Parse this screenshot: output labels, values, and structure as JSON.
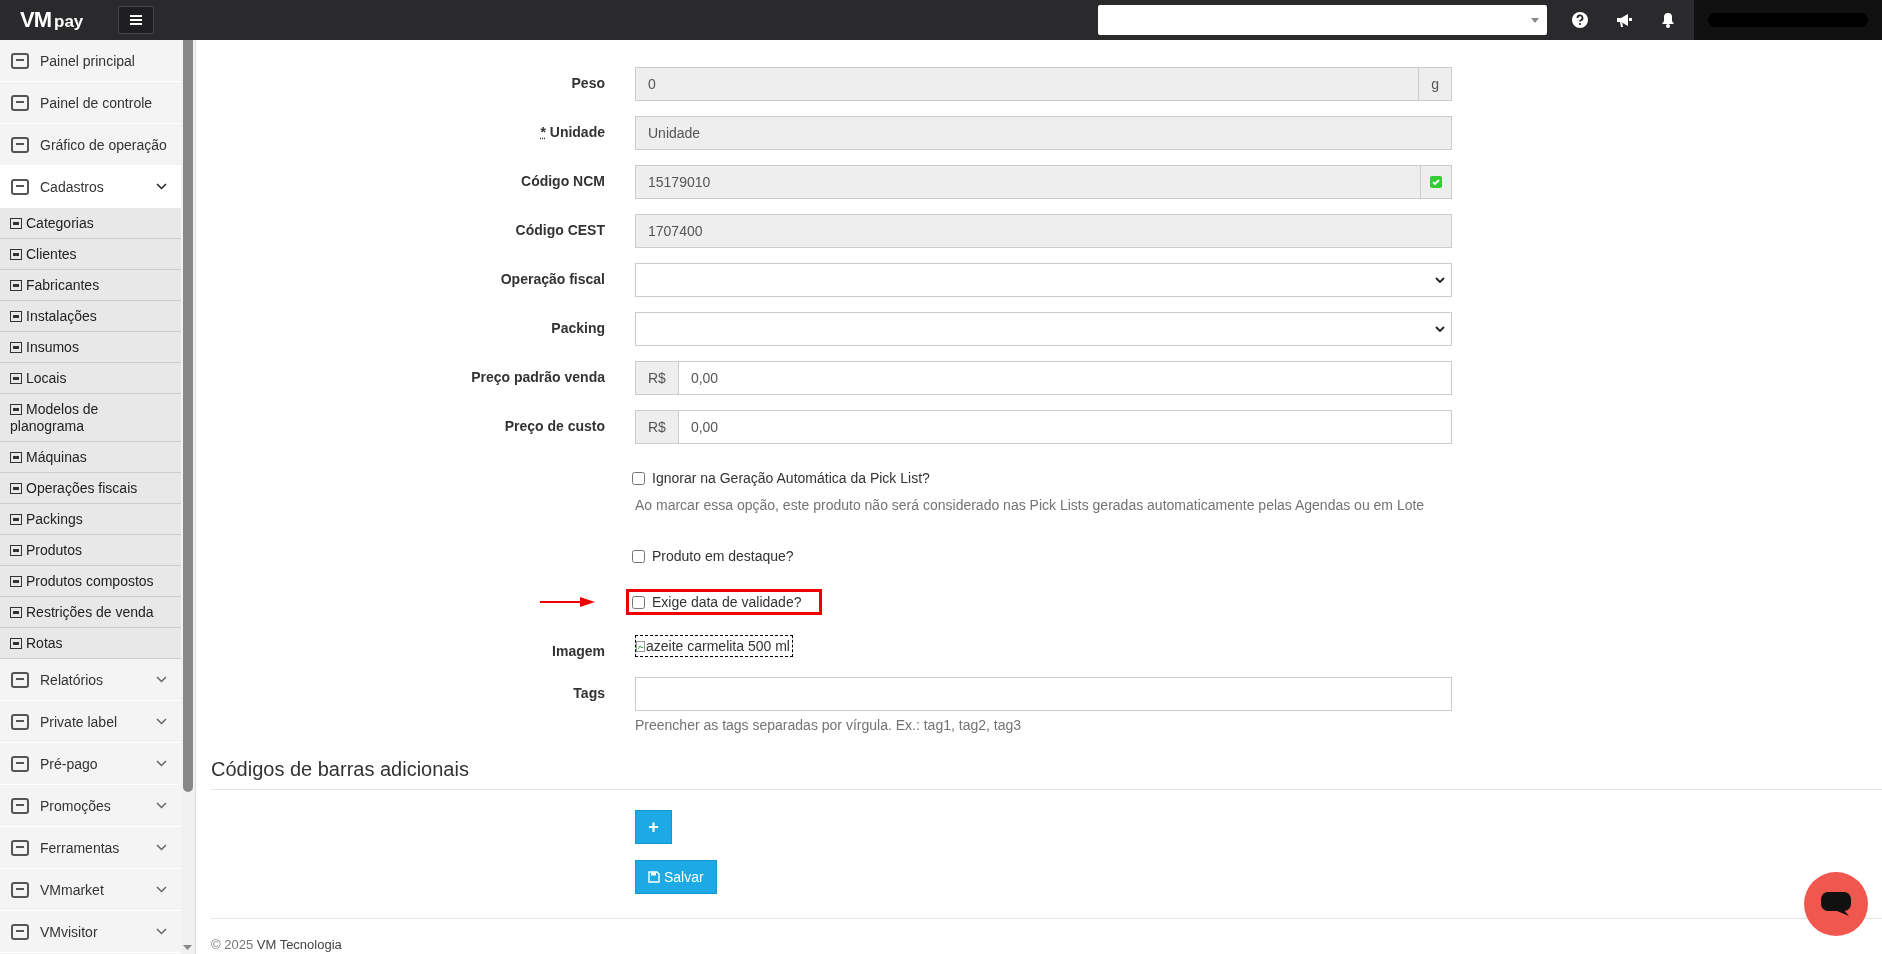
{
  "topbar": {
    "logo_main": "VM",
    "logo_sub": "pay"
  },
  "sidebar": {
    "items": [
      {
        "label": "Painel principal"
      },
      {
        "label": "Painel de controle"
      },
      {
        "label": "Gráfico de operação"
      },
      {
        "label": "Cadastros",
        "expanded": true,
        "children": [
          {
            "label": "Categorias"
          },
          {
            "label": "Clientes"
          },
          {
            "label": "Fabricantes"
          },
          {
            "label": "Instalações"
          },
          {
            "label": "Insumos"
          },
          {
            "label": "Locais"
          },
          {
            "label": "Modelos de planograma"
          },
          {
            "label": "Máquinas"
          },
          {
            "label": "Operações fiscais"
          },
          {
            "label": "Packings"
          },
          {
            "label": "Produtos"
          },
          {
            "label": "Produtos compostos"
          },
          {
            "label": "Restrições de venda"
          },
          {
            "label": "Rotas"
          }
        ]
      },
      {
        "label": "Relatórios",
        "expanded": false
      },
      {
        "label": "Private label",
        "expanded": false
      },
      {
        "label": "Pré-pago",
        "expanded": false
      },
      {
        "label": "Promoções",
        "expanded": false
      },
      {
        "label": "Ferramentas",
        "expanded": false
      },
      {
        "label": "VMmarket",
        "expanded": false
      },
      {
        "label": "VMvisitor",
        "expanded": false
      }
    ]
  },
  "form": {
    "fields": [
      {
        "kind": "input",
        "label": "Peso",
        "value": "0",
        "suffix": "g",
        "readonly": true
      },
      {
        "kind": "input",
        "label": "Unidade",
        "required_mark": "*",
        "value": "Unidade",
        "readonly": true
      },
      {
        "kind": "input",
        "label": "Código NCM",
        "value": "15179010",
        "valid": true,
        "readonly": true
      },
      {
        "kind": "input",
        "label": "Código CEST",
        "value": "1707400",
        "readonly": true
      },
      {
        "kind": "select",
        "label": "Operação fiscal"
      },
      {
        "kind": "select",
        "label": "Packing"
      },
      {
        "kind": "input",
        "label": "Preço padrão venda",
        "prefix": "R$",
        "value": "0,00",
        "readonly": false
      },
      {
        "kind": "input",
        "label": "Preço de custo",
        "prefix": "R$",
        "value": "0,00",
        "readonly": false
      }
    ],
    "checkboxes": [
      {
        "label": "Ignorar na Geração Automática da Pick List?",
        "checked": false,
        "help": "Ao marcar essa opção, este produto não será considerado nas Pick Lists geradas automaticamente pelas Agendas ou em Lote",
        "highlighted": false
      },
      {
        "label": "Produto em destaque?",
        "checked": false,
        "highlighted": false
      },
      {
        "label": "Exige data de validade?",
        "checked": false,
        "highlighted": true
      }
    ],
    "image": {
      "label": "Imagem",
      "alt": "azeite carmelita 500 ml"
    },
    "tags": {
      "label": "Tags",
      "help": "Preencher as tags separadas por vírgula. Ex.: tag1, tag2, tag3"
    }
  },
  "barcodes": {
    "title": "Códigos de barras adicionais",
    "add_button": "+",
    "save_button": "Salvar"
  },
  "footer": {
    "copyright": "© 2025",
    "company": "VM Tecnologia"
  }
}
